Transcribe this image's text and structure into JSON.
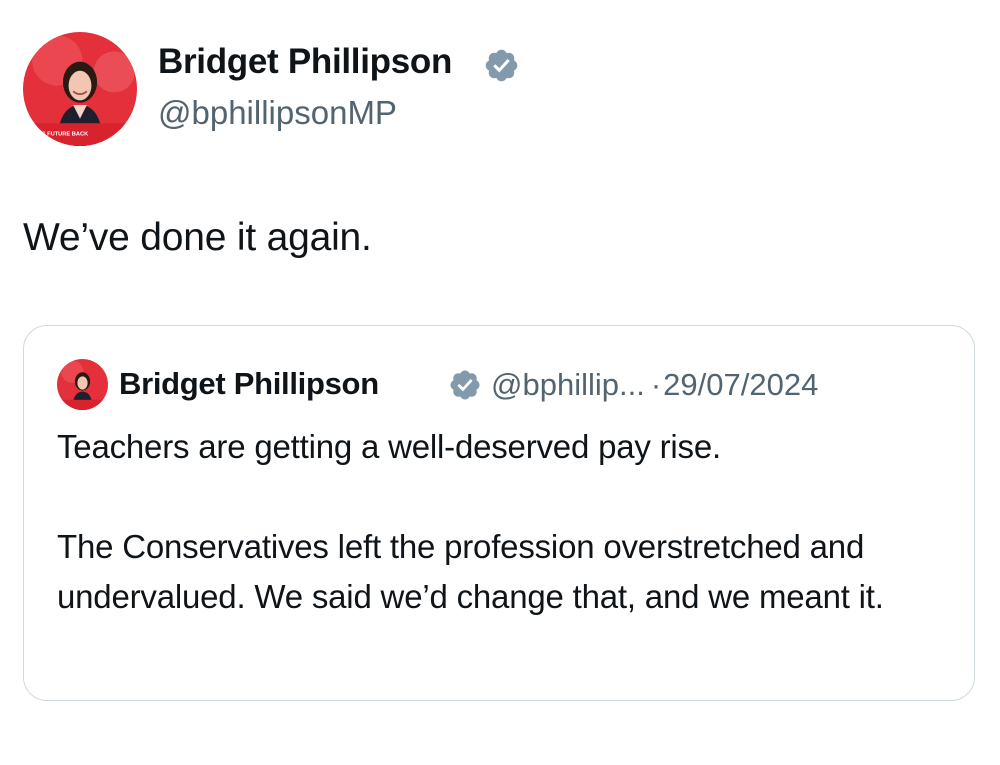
{
  "tweet": {
    "author": {
      "name": "Bridget Phillipson",
      "handle": "@bphillipsonMP",
      "verified": true,
      "avatar_icon": "profile-photo"
    },
    "text": "We’ve done it again."
  },
  "quoted_tweet": {
    "author": {
      "name": "Bridget Phillipson",
      "handle_truncated": "@bphillip...",
      "verified": true
    },
    "separator": "·",
    "date": "29/07/2024",
    "paragraphs": [
      "Teachers are getting a well-deserved pay rise.",
      "The Conservatives left the profession overstretched and undervalued.  We said we’d change that, and we meant it."
    ]
  },
  "colors": {
    "text_primary": "#0f1419",
    "text_secondary": "#536471",
    "border": "#cfd9de",
    "verified_badge": "#829aab",
    "avatar_background": "#e4303b"
  }
}
